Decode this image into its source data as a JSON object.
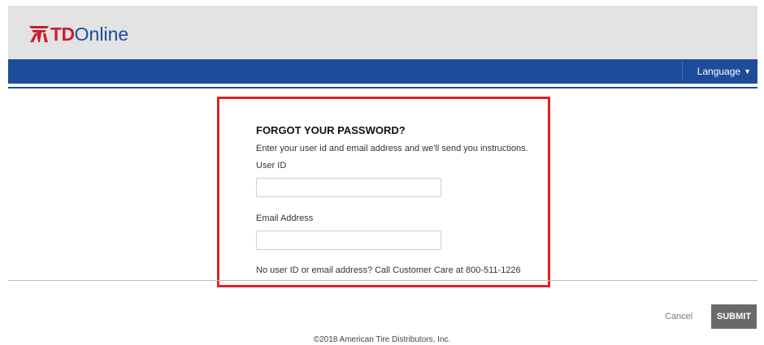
{
  "brand": {
    "logo_td": "TD",
    "logo_online": "Online",
    "red": "#c8202f",
    "blue": "#1d4c9a"
  },
  "nav": {
    "language_label": "Language",
    "language_icon": "caret-down-icon"
  },
  "form": {
    "title": "FORGOT YOUR PASSWORD?",
    "description": "Enter your user id and email address and we'll send you instructions.",
    "user_id_label": "User ID",
    "user_id_value": "",
    "email_label": "Email Address",
    "email_value": "",
    "help_text": "No user ID or email address? Call Customer Care at 800-511-1226",
    "highlight_color": "#e0202a"
  },
  "actions": {
    "cancel_label": "Cancel",
    "submit_label": "SUBMIT"
  },
  "footer": {
    "copyright": "©2018 American Tire Distributors, Inc."
  }
}
